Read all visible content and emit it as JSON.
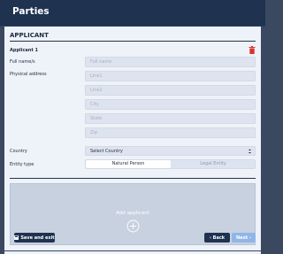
{
  "header": {
    "title": "Parties"
  },
  "section": {
    "title": "APPLICANT"
  },
  "applicant": {
    "label": "Applicant 1",
    "full_name": {
      "label": "Full name/s",
      "placeholder": "Full name",
      "value": ""
    },
    "address": {
      "label": "Physical address",
      "fields": [
        {
          "placeholder": "Line1",
          "value": ""
        },
        {
          "placeholder": "Line2",
          "value": ""
        },
        {
          "placeholder": "City",
          "value": ""
        },
        {
          "placeholder": "State",
          "value": ""
        },
        {
          "placeholder": "Zip",
          "value": ""
        }
      ]
    },
    "country": {
      "label": "Country",
      "selected": "Select Country"
    },
    "entity_type": {
      "label": "Entity type",
      "options": [
        "Natural Person",
        "Legal Entity"
      ],
      "selected": "Natural Person"
    }
  },
  "add_applicant": {
    "label": "Add applicant"
  },
  "footer": {
    "save_label": "Save and exit",
    "back_label": "‹ Back",
    "next_label": "Next ›"
  },
  "colors": {
    "header_bg": "#1f3250",
    "page_bg": "#3a4860",
    "card_bg": "#eef2f9",
    "delete_icon": "#d9342b",
    "next_button": "#8fb6e8"
  }
}
